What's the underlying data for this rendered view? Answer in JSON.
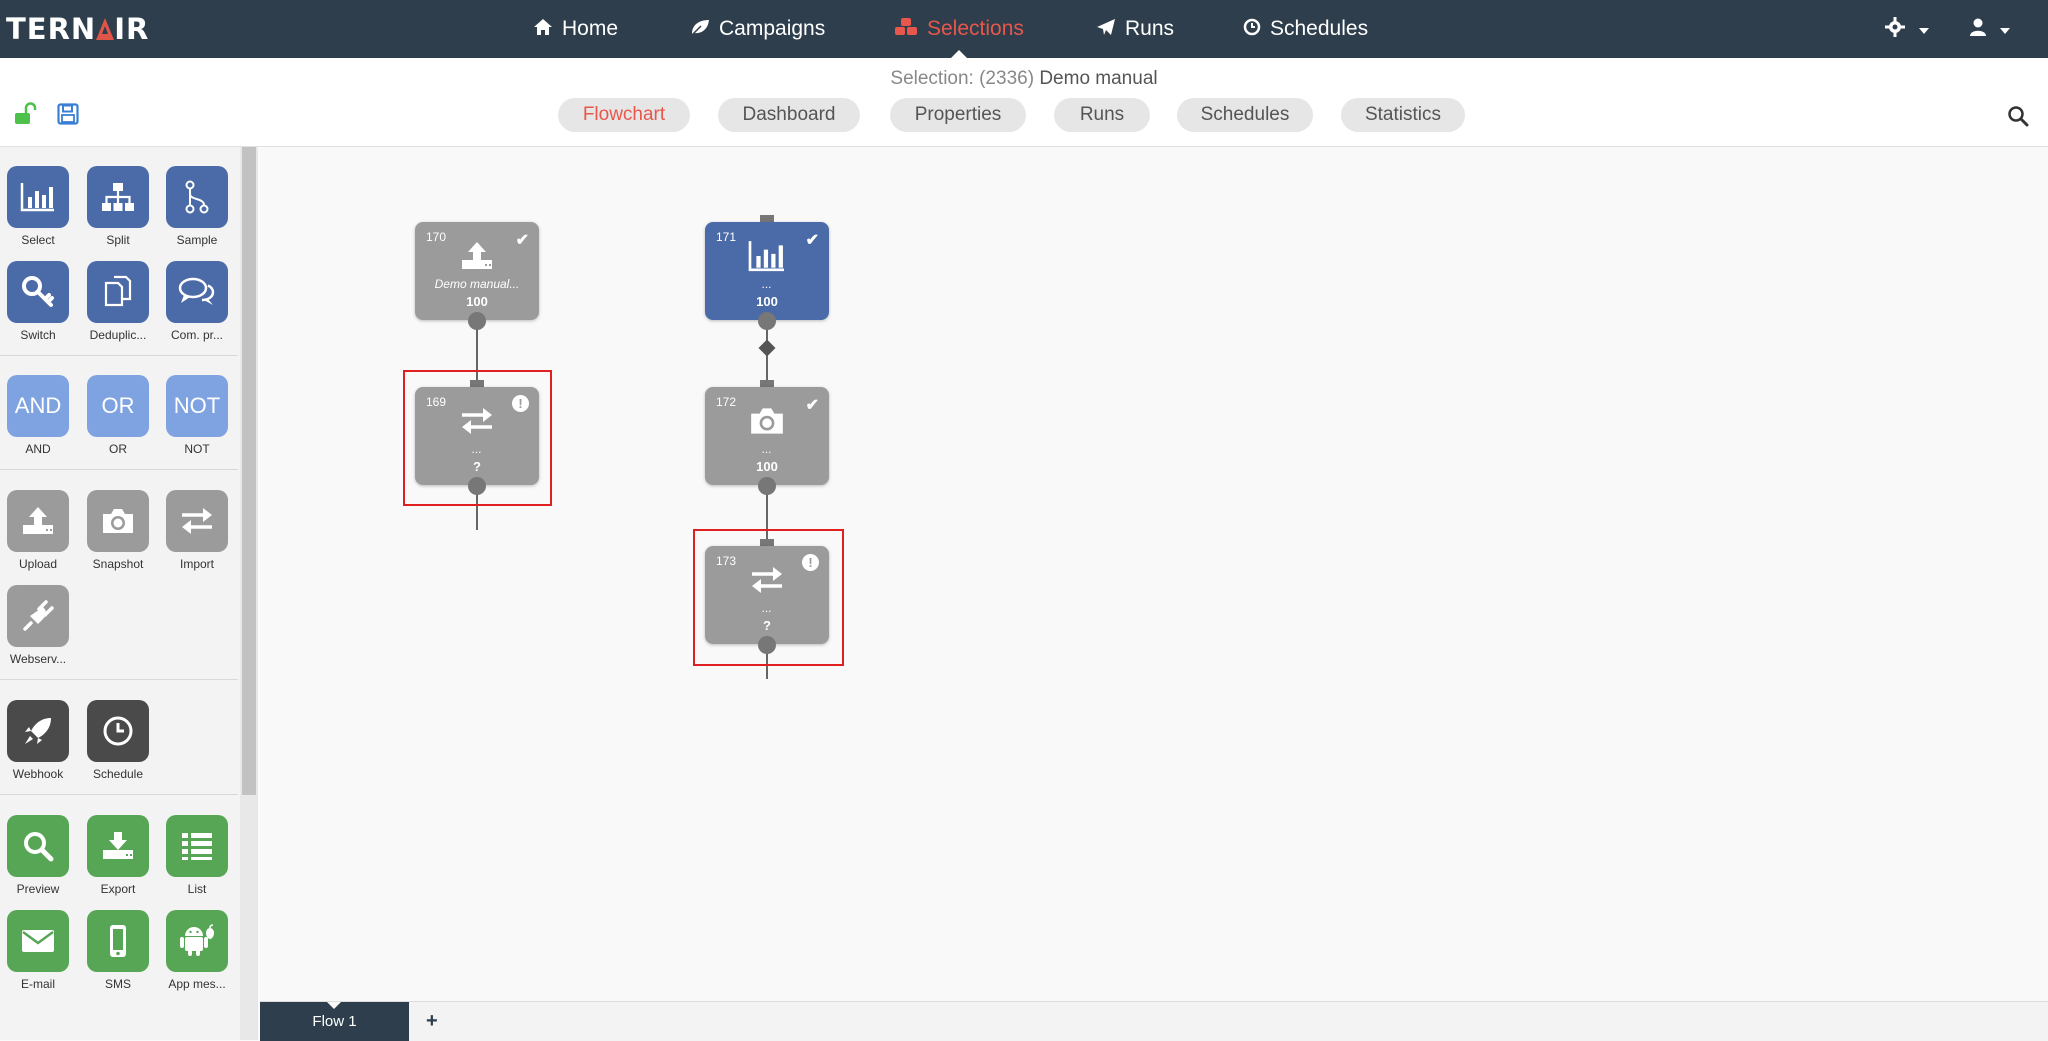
{
  "brand": {
    "logo_left": "TERN",
    "logo_right": "IR"
  },
  "nav": [
    {
      "label": "Home",
      "icon": "home-icon",
      "active": false
    },
    {
      "label": "Campaigns",
      "icon": "leaf-icon",
      "active": false
    },
    {
      "label": "Selections",
      "icon": "cubes-icon",
      "active": true
    },
    {
      "label": "Runs",
      "icon": "paper-plane-icon",
      "active": false
    },
    {
      "label": "Schedules",
      "icon": "clock-icon",
      "active": false
    }
  ],
  "header": {
    "selection_prefix": "Selection: (2336)",
    "selection_name": "Demo manual"
  },
  "tabs": [
    {
      "label": "Flowchart",
      "active": true
    },
    {
      "label": "Dashboard",
      "active": false
    },
    {
      "label": "Properties",
      "active": false
    },
    {
      "label": "Runs",
      "active": false
    },
    {
      "label": "Schedules",
      "active": false
    },
    {
      "label": "Statistics",
      "active": false
    }
  ],
  "palette": {
    "select": "Select",
    "split": "Split",
    "sample": "Sample",
    "switch": "Switch",
    "deduplicate": "Deduplic...",
    "compr": "Com. pr...",
    "and": "AND",
    "or": "OR",
    "not": "NOT",
    "upload": "Upload",
    "snapshot": "Snapshot",
    "import": "Import",
    "webservice": "Webserv...",
    "webhook": "Webhook",
    "schedule": "Schedule",
    "preview": "Preview",
    "export": "Export",
    "list": "List",
    "email": "E-mail",
    "sms": "SMS",
    "appmsg": "App mes..."
  },
  "nodes": {
    "n170": {
      "id": "170",
      "name": "Demo manual...",
      "count": "100",
      "status": "ok",
      "type": "upload"
    },
    "n169": {
      "id": "169",
      "name": "...",
      "count": "?",
      "status": "warning",
      "type": "import"
    },
    "n171": {
      "id": "171",
      "name": "...",
      "count": "100",
      "status": "ok",
      "type": "select"
    },
    "n172": {
      "id": "172",
      "name": "...",
      "count": "100",
      "status": "ok",
      "type": "snapshot"
    },
    "n173": {
      "id": "173",
      "name": "...",
      "count": "?",
      "status": "warning",
      "type": "import"
    }
  },
  "flows": {
    "tab1": "Flow 1",
    "add": "+"
  },
  "colors": {
    "topbar": "#2e3e4c",
    "accent": "#e8574b",
    "node_gray": "#9b9b9b",
    "node_blue": "#4b6aa8",
    "highlight": "#e02020",
    "green": "#56a655"
  }
}
